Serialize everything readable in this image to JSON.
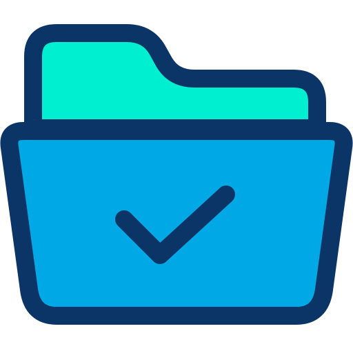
{
  "icon": {
    "name": "folder-check-icon",
    "colors": {
      "outline": "#0B3566",
      "back_panel": "#00EFD1",
      "front_panel": "#00A9E6",
      "background": "#FFFFFF"
    }
  }
}
